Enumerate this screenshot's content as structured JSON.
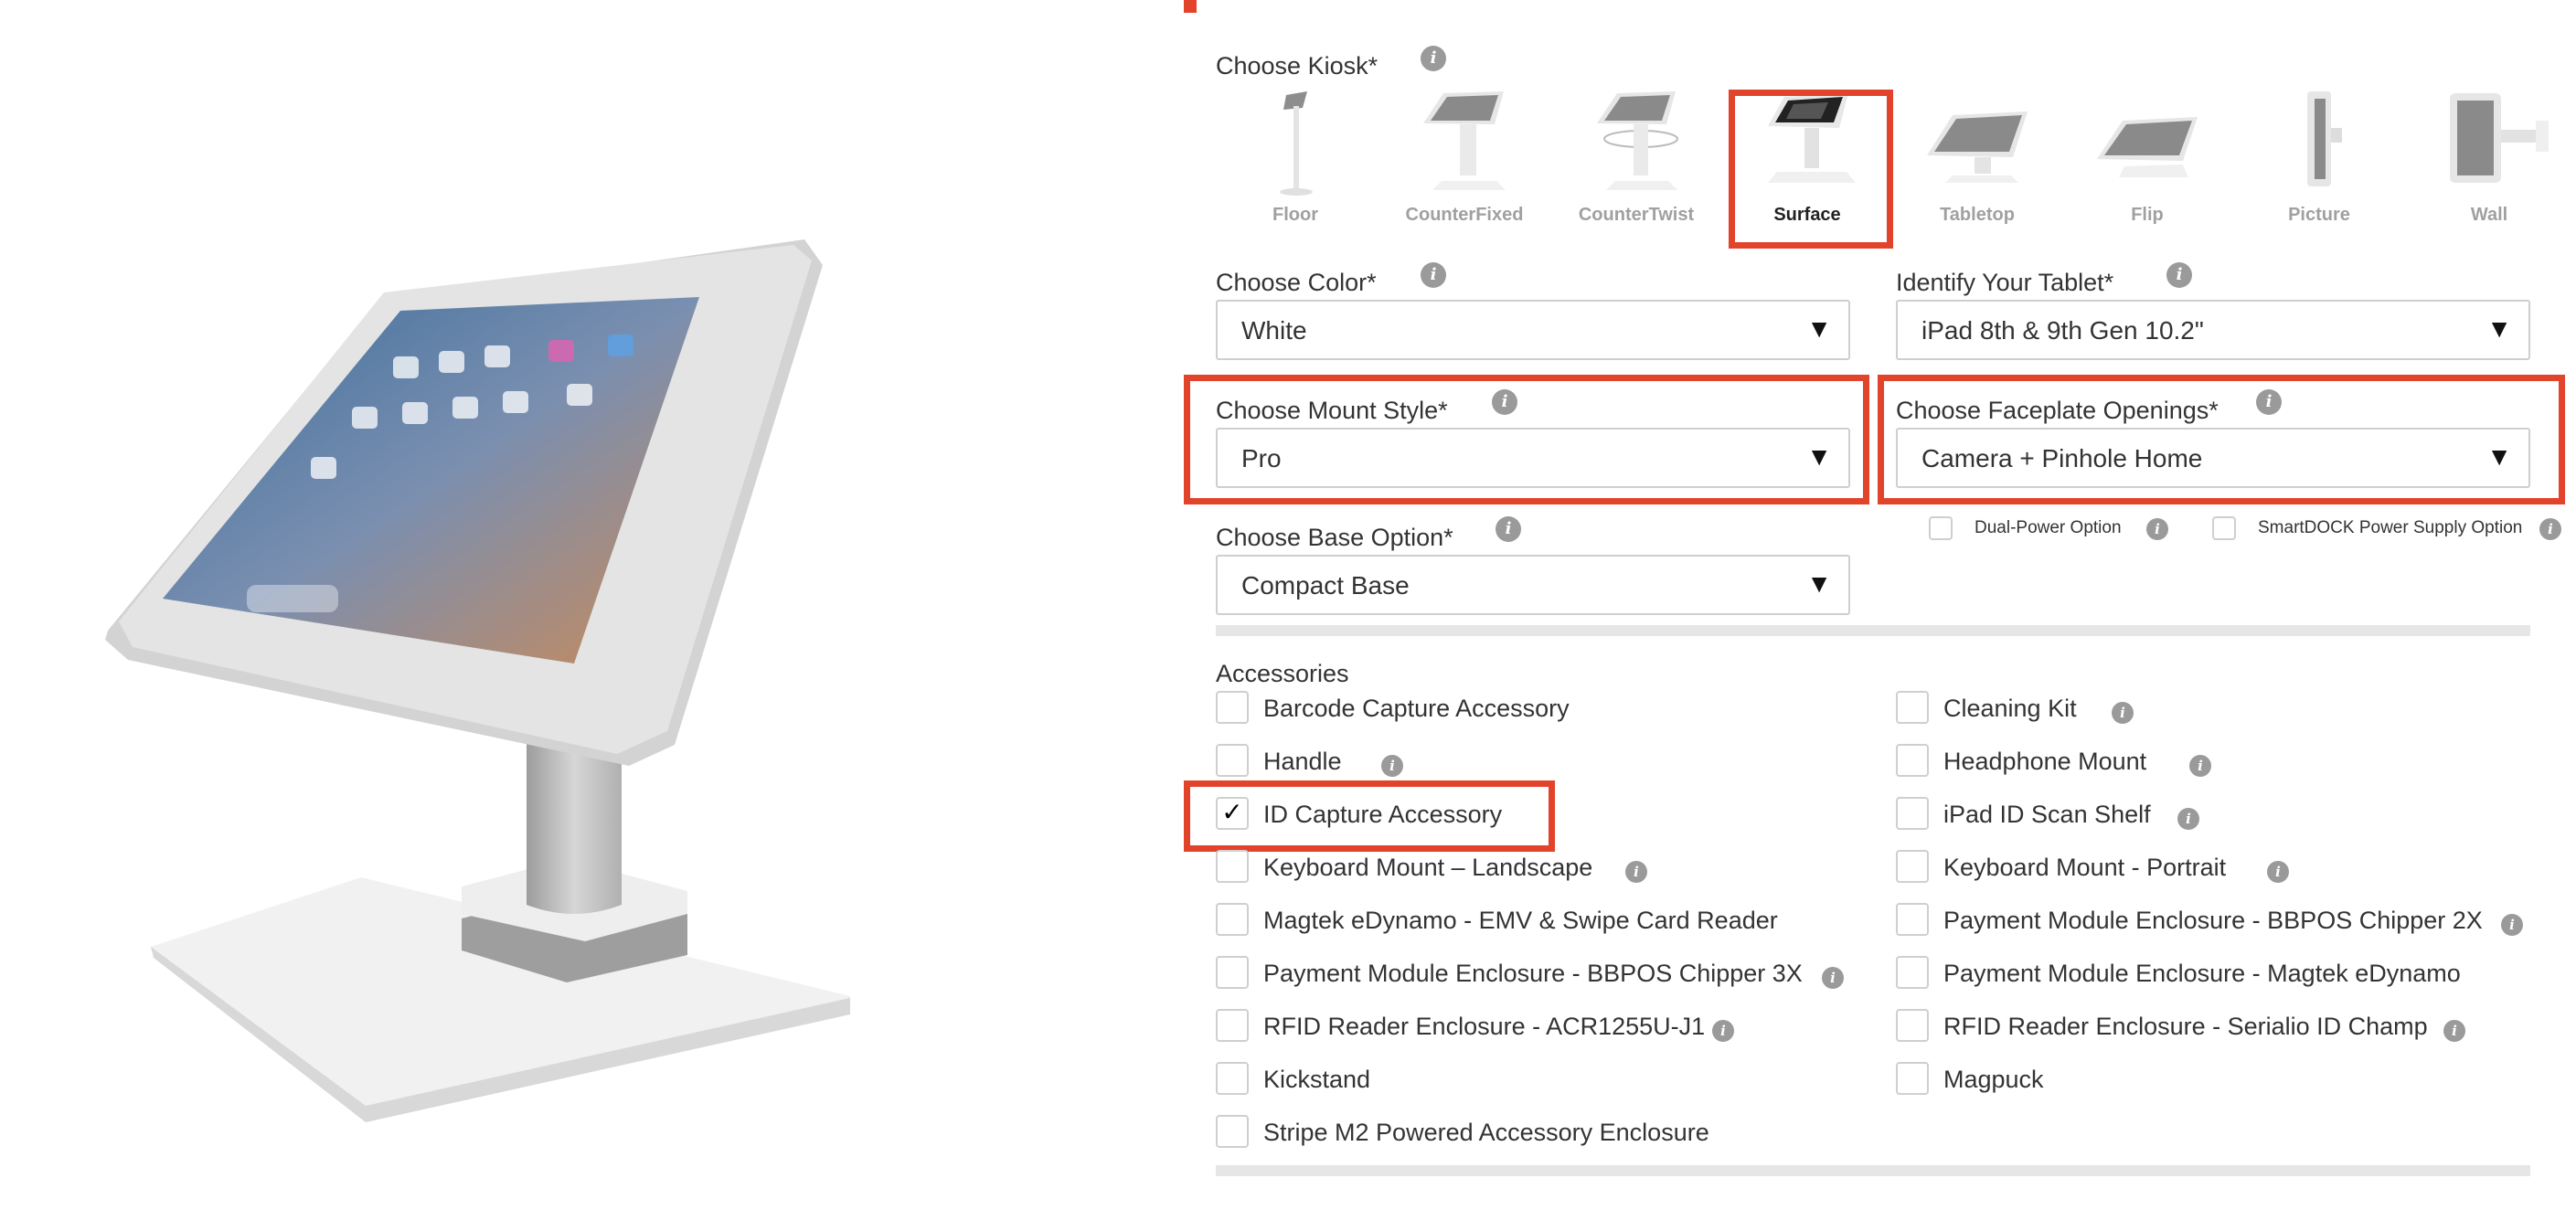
{
  "kiosk": {
    "label": "Choose Kiosk*",
    "options": [
      {
        "label": "Floor"
      },
      {
        "label": "CounterFixed"
      },
      {
        "label": "CounterTwist"
      },
      {
        "label": "Surface"
      },
      {
        "label": "Tabletop"
      },
      {
        "label": "Flip"
      },
      {
        "label": "Picture"
      },
      {
        "label": "Wall"
      }
    ],
    "selected": "Surface"
  },
  "color": {
    "label": "Choose Color*",
    "value": "White"
  },
  "tablet": {
    "label": "Identify Your Tablet*",
    "value": "iPad 8th & 9th Gen 10.2\""
  },
  "mount": {
    "label": "Choose Mount Style*",
    "value": "Pro"
  },
  "faceplate": {
    "label": "Choose Faceplate Openings*",
    "value": "Camera + Pinhole Home"
  },
  "base": {
    "label": "Choose Base Option*",
    "value": "Compact Base"
  },
  "power": {
    "dual": "Dual-Power Option",
    "smartdock": "SmartDOCK Power Supply Option"
  },
  "accessories": {
    "title": "Accessories",
    "left": [
      {
        "label": "Barcode Capture Accessory",
        "checked": false
      },
      {
        "label": "Handle",
        "checked": false
      },
      {
        "label": "ID Capture Accessory",
        "checked": true
      },
      {
        "label": "Keyboard Mount – Landscape",
        "checked": false
      },
      {
        "label": "Magtek eDynamo - EMV & Swipe Card Reader",
        "checked": false
      },
      {
        "label": "Payment Module Enclosure - BBPOS Chipper 3X",
        "checked": false
      },
      {
        "label": "RFID Reader Enclosure - ACR1255U-J1",
        "checked": false
      },
      {
        "label": "Kickstand",
        "checked": false
      },
      {
        "label": "Stripe M2 Powered Accessory Enclosure",
        "checked": false
      }
    ],
    "right": [
      {
        "label": "Cleaning Kit",
        "checked": false
      },
      {
        "label": "Headphone Mount",
        "checked": false
      },
      {
        "label": "iPad ID Scan Shelf",
        "checked": false
      },
      {
        "label": "Keyboard Mount - Portrait",
        "checked": false
      },
      {
        "label": "Payment Module Enclosure - BBPOS Chipper 2X",
        "checked": false
      },
      {
        "label": "Payment Module Enclosure - Magtek eDynamo",
        "checked": false
      },
      {
        "label": "RFID Reader Enclosure - Serialio ID Champ",
        "checked": false
      },
      {
        "label": "Magpuck",
        "checked": false
      }
    ]
  },
  "icons": {
    "info": "info-icon",
    "dropdown": "caret-down-icon",
    "check": "✓",
    "info_glyph": "i",
    "arrow_glyph": "▼"
  },
  "colors": {
    "highlight": "#e2432b",
    "selected_label": "#222222",
    "unselected_label": "#a0a0a0"
  }
}
